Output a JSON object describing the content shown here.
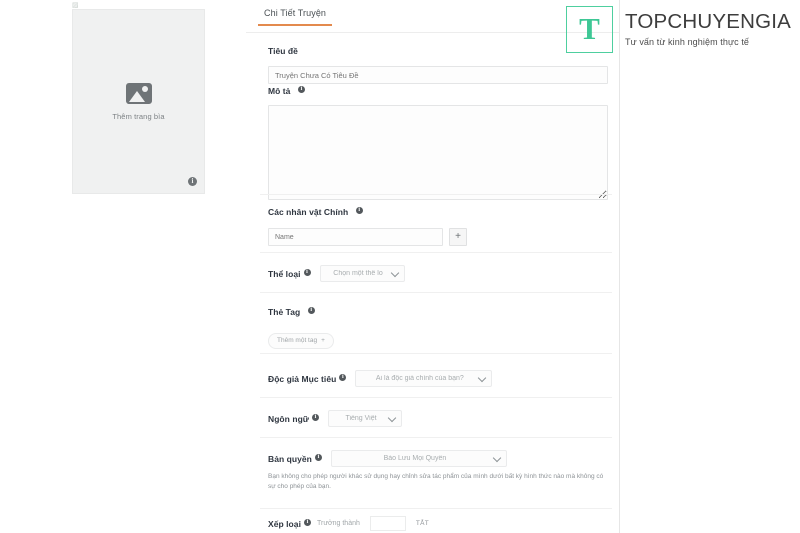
{
  "cover": {
    "broken_image_glyph": "▨",
    "add_cover_label": "Thêm trang bìa",
    "info_badge": "i",
    "image_icon_name": "image-placeholder-icon"
  },
  "tabs": [
    {
      "label": "Chi Tiết Truyện",
      "active": true
    }
  ],
  "form": {
    "title": {
      "label": "Tiêu đề",
      "placeholder": "Truyện Chưa Có Tiêu Đề",
      "value": ""
    },
    "description": {
      "label": "Mô tả",
      "placeholder": "",
      "value": ""
    },
    "characters": {
      "label": "Các nhân vật Chính",
      "placeholder": "Name",
      "value": "",
      "add_button": "+"
    },
    "genre": {
      "label": "Thể loại",
      "value": "Chọn một thể lo"
    },
    "tags": {
      "label": "Thẻ Tag",
      "add_tag_label": "Thêm một tag",
      "add_tag_plus": "+"
    },
    "audience": {
      "label": "Độc giả Mục tiêu",
      "value": "Ai là độc giả chính của bạn?"
    },
    "language": {
      "label": "Ngôn ngữ",
      "value": "Tiếng Việt"
    },
    "copyright": {
      "label": "Bản quyền",
      "value": "Bảo Lưu Mọi Quyền",
      "helper": "Bạn không cho phép người khác sử dụng hay chỉnh sửa tác phẩm của mình dưới bất kỳ hình thức nào mà không có sự cho phép của bạn."
    },
    "rating": {
      "label": "Xếp loại",
      "value": "Trưởng thành",
      "toggle_state": "TẮT"
    },
    "info_icon": "i"
  },
  "brand": {
    "mark_letter": "T",
    "name": "TOPCHUYENGIA",
    "tagline": "Tư vấn từ kinh nghiệm thực tế"
  },
  "colors": {
    "tab_accent": "#e38a4e",
    "brand_green": "#3ec795",
    "field_border": "#e4e5e6",
    "cover_bg": "#f0f1f1"
  }
}
